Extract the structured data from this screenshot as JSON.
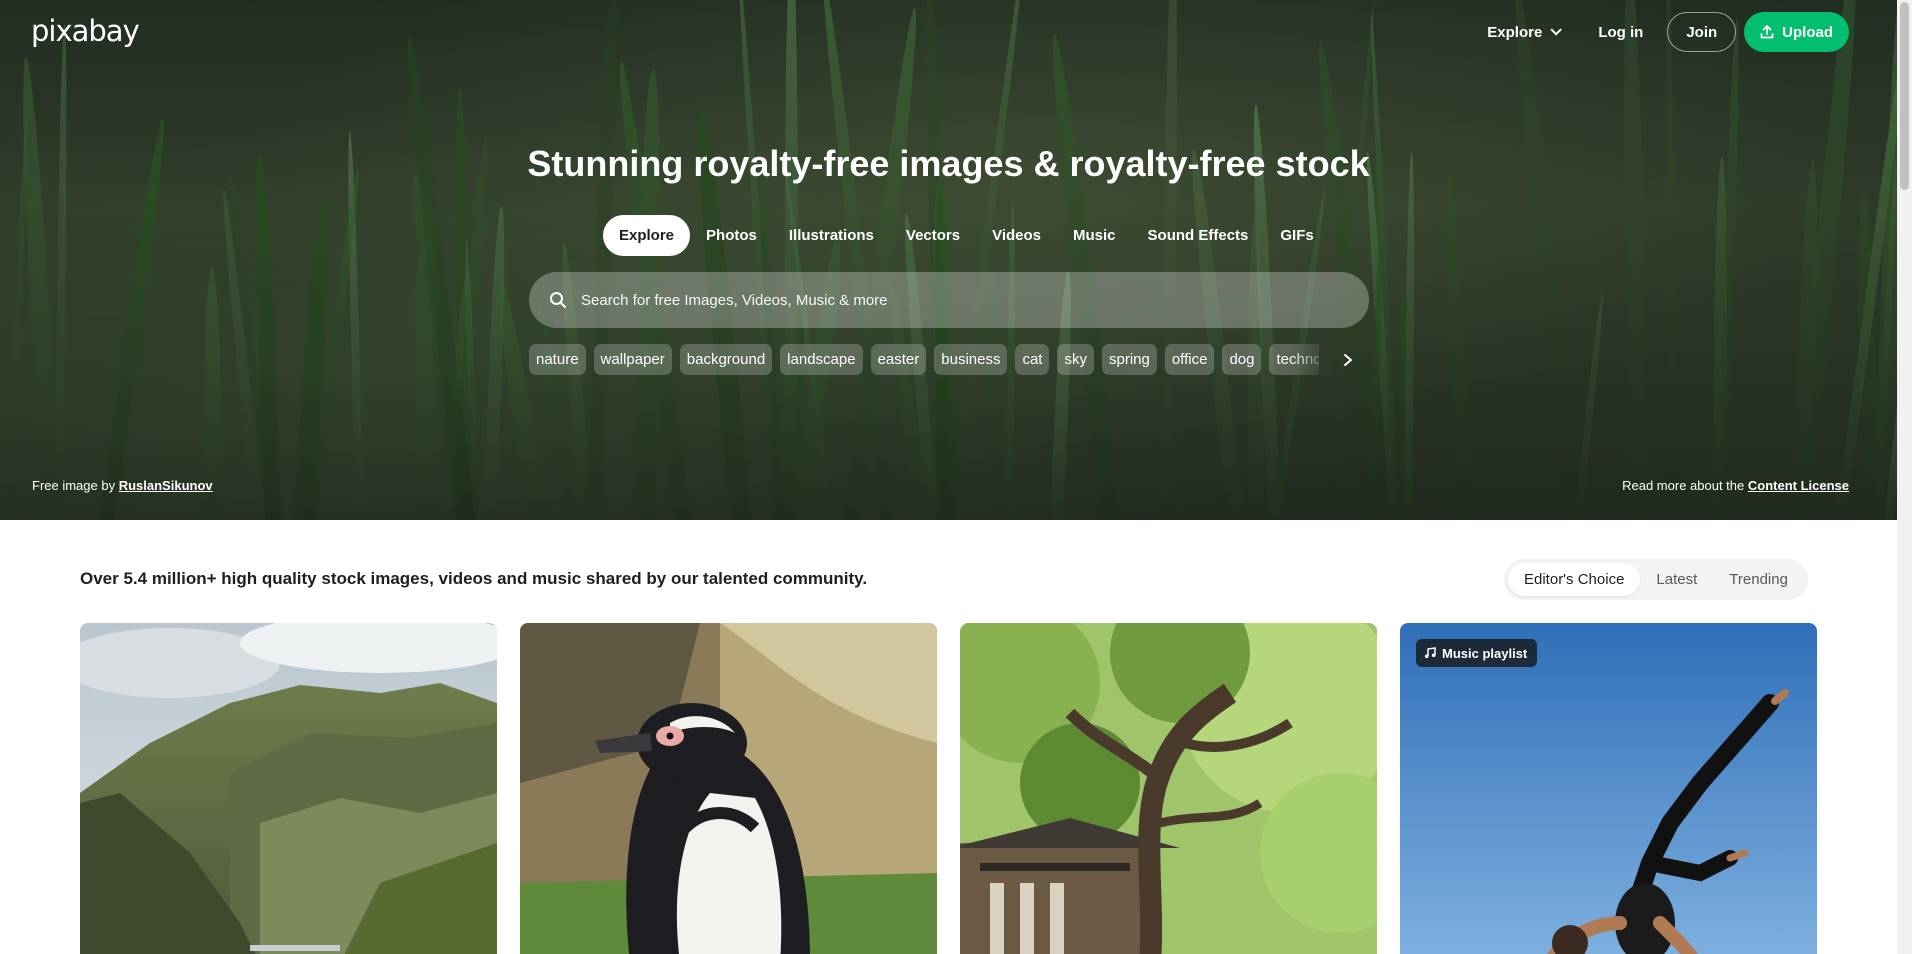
{
  "brand": {
    "logo_text": "pixabay"
  },
  "topnav": {
    "explore_label": "Explore",
    "login_label": "Log in",
    "join_label": "Join",
    "upload_label": "Upload"
  },
  "hero": {
    "headline": "Stunning royalty-free images & royalty-free stock",
    "tabs": [
      {
        "label": "Explore",
        "active": true
      },
      {
        "label": "Photos"
      },
      {
        "label": "Illustrations"
      },
      {
        "label": "Vectors"
      },
      {
        "label": "Videos"
      },
      {
        "label": "Music"
      },
      {
        "label": "Sound Effects"
      },
      {
        "label": "GIFs"
      }
    ],
    "search": {
      "placeholder": "Search for free Images, Videos, Music & more",
      "value": ""
    },
    "tags": [
      "nature",
      "wallpaper",
      "background",
      "landscape",
      "easter",
      "business",
      "cat",
      "sky",
      "spring",
      "office",
      "dog",
      "technology"
    ],
    "credit_prefix": "Free image by",
    "credit_author": "RuslanSikunov",
    "license_prefix": "Read more about the",
    "license_link": "Content License"
  },
  "content": {
    "tagline": "Over 5.4 million+ high quality stock images, videos and music shared by our talented community.",
    "sort_options": [
      {
        "label": "Editor's Choice",
        "active": true
      },
      {
        "label": "Latest"
      },
      {
        "label": "Trending"
      }
    ],
    "cards": [
      {
        "subject": "mountain valley"
      },
      {
        "subject": "penguin"
      },
      {
        "subject": "tree and temple"
      },
      {
        "subject": "yoga pose",
        "badge": "Music playlist"
      }
    ]
  },
  "colors": {
    "accent_green": "#02be6e",
    "text_dark": "#1f1f1f"
  }
}
